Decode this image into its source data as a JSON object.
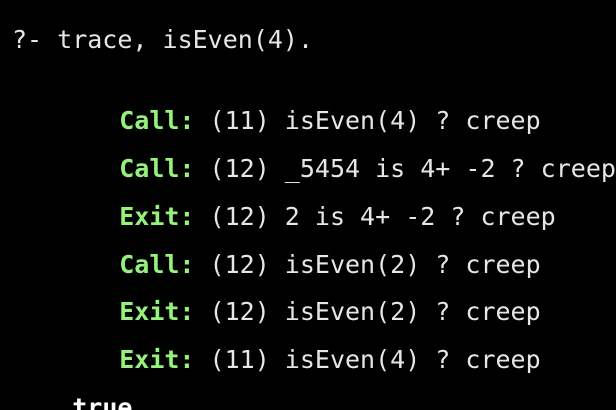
{
  "terminal": {
    "prompt_line": "?- trace, isEven(4).",
    "trace_lines": [
      {
        "port": "Call:",
        "text": " (11) isEven(4) ? creep"
      },
      {
        "port": "Call:",
        "text": " (12) _5454 is 4+ -2 ? creep"
      },
      {
        "port": "Exit:",
        "text": " (12) 2 is 4+ -2 ? creep"
      },
      {
        "port": "Call:",
        "text": " (12) isEven(2) ? creep"
      },
      {
        "port": "Exit:",
        "text": " (12) isEven(2) ? creep"
      },
      {
        "port": "Exit:",
        "text": " (11) isEven(4) ? creep"
      }
    ],
    "result": "true",
    "result_suffix": " ."
  },
  "colors": {
    "background": "#000000",
    "text": "#e6e6e6",
    "port": "#95f27a",
    "result": "#ffffff"
  }
}
